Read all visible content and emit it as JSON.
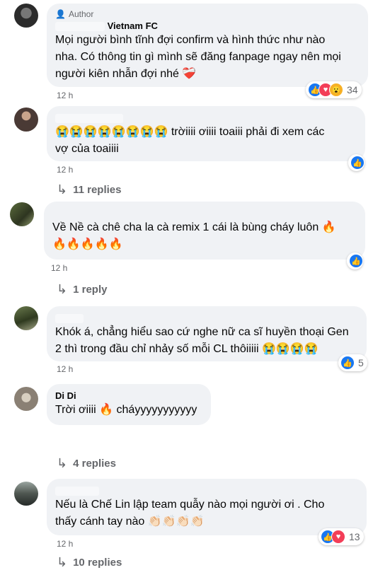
{
  "comments": [
    {
      "badge": "Author",
      "name": "Vietnam FC",
      "lines": [
        "Mọi người bình tĩnh đợi confirm và hình thức như nào",
        "nha. Có thông tin gì mình sẽ đăng fanpage ngay nên mọi",
        "người kiên nhẫn đợi nhé ❤️‍🩹"
      ],
      "time": "12 h",
      "react_count": "34",
      "reactions": [
        "like-icon",
        "love-icon",
        "wow-icon"
      ]
    },
    {
      "lines": [
        "😭😭😭😭😭😭😭😭 trờiiii ơiiii toaiii phải đi xem các",
        "vợ của toaiiii"
      ],
      "time": "12 h",
      "replies": "11 replies",
      "reactions": [
        "like-icon"
      ]
    },
    {
      "lines": [
        "Về Nề cà chê cha la cà remix 1 cái là bùng cháy luôn 🔥",
        "🔥🔥🔥🔥🔥"
      ],
      "time": "12 h",
      "replies": "1 reply",
      "reactions": [
        "like-icon"
      ]
    },
    {
      "lines": [
        "Khók á, chẳng hiểu sao cứ nghe nữ ca sĩ huyền thoại Gen",
        "2 thì trong đầu chỉ nhảy số mỗi CL thôiiiii 😭😭😭😭"
      ],
      "time": "12 h",
      "react_count": "5",
      "reactions": [
        "like-icon"
      ]
    },
    {
      "name": "Di Di",
      "lines": [
        "Trời ơiiii 🔥 cháyyyyyyyyyyy"
      ],
      "replies": "4 replies"
    },
    {
      "lines": [
        "Nếu là Chế Lin lập team quẫy nào mọi người ơi . Cho",
        "thấy cánh tay nào 👏🏻👏🏻👏🏻👏🏻"
      ],
      "time": "12 h",
      "react_count": "13",
      "replies": "10 replies",
      "reactions": [
        "like-icon",
        "love-icon"
      ]
    }
  ],
  "colors": {
    "bubble": "#f0f2f5",
    "meta": "#65676b",
    "like": "#1877f2",
    "love": "#f33e58",
    "wow": "#f7b125"
  }
}
